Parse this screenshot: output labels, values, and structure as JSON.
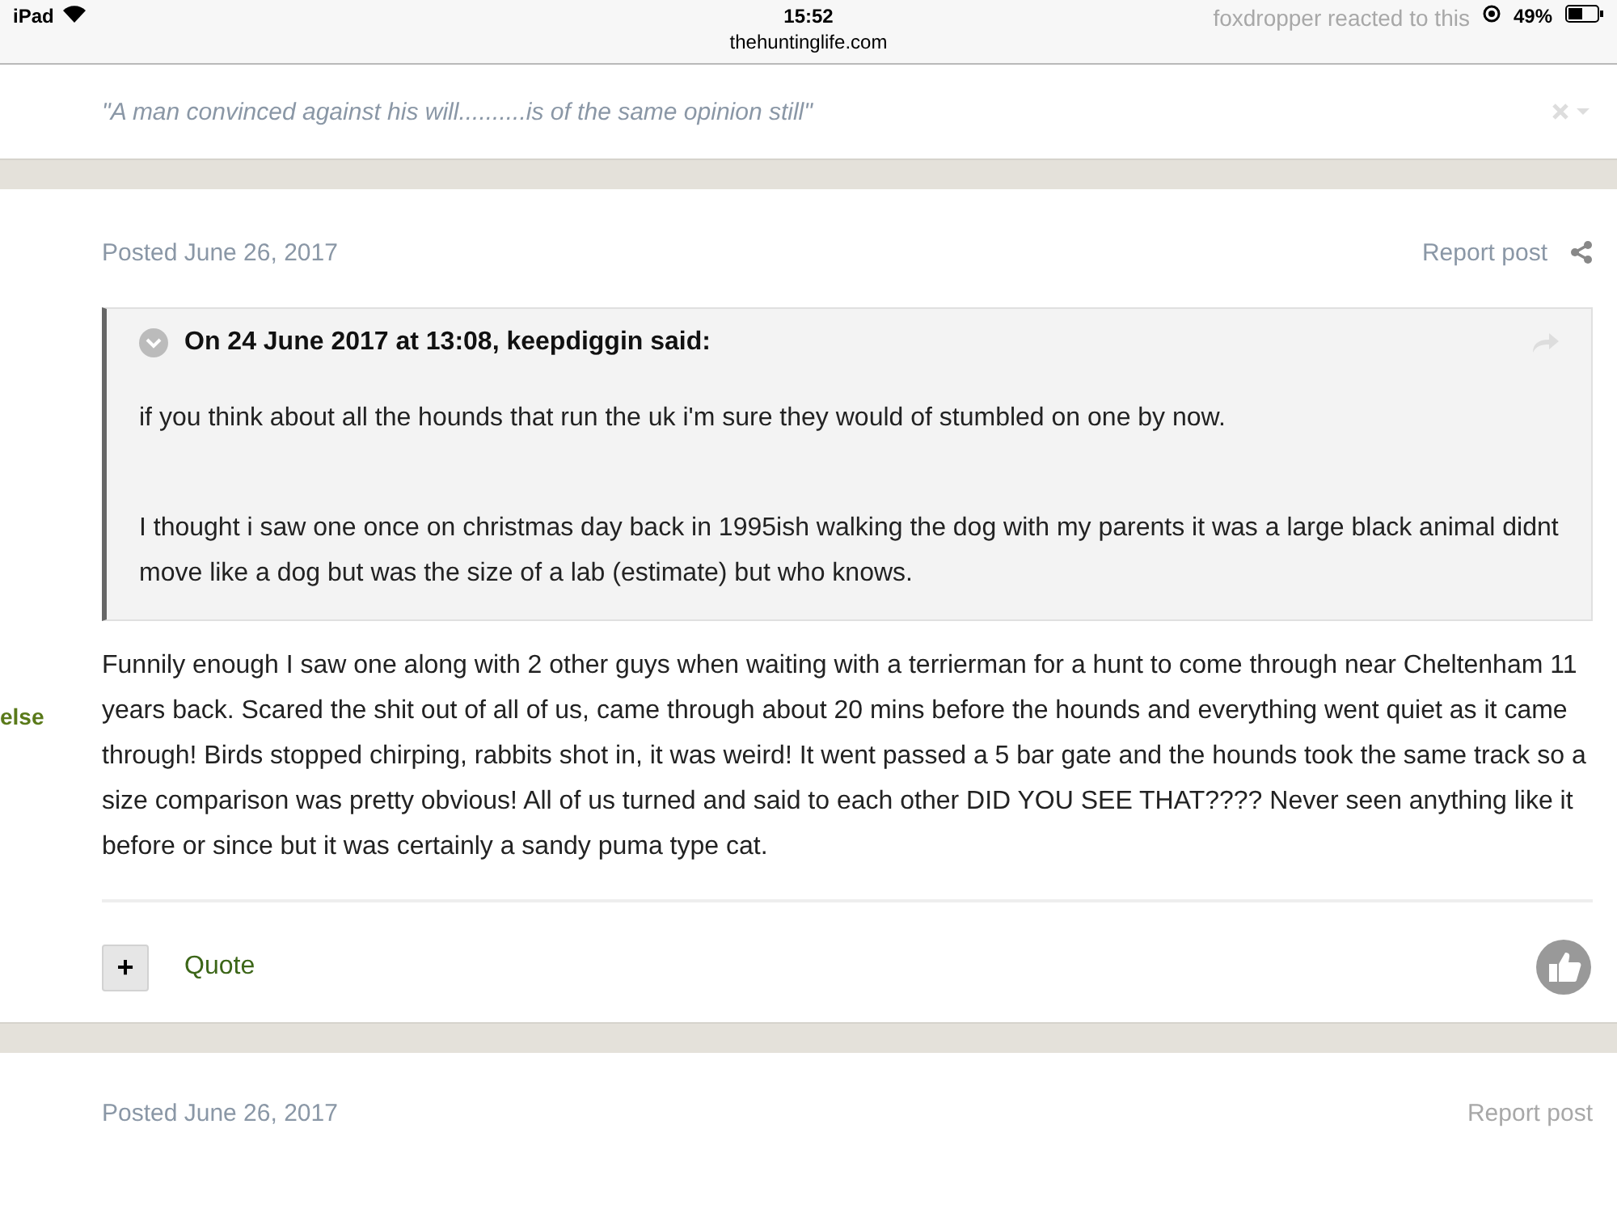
{
  "status_bar": {
    "device": "iPad",
    "time": "15:52",
    "url": "thehuntinglife.com",
    "notification": "foxdropper reacted to this",
    "battery": "49%"
  },
  "signature": {
    "text": "\"A man convinced against his will..........is of the same opinion still\""
  },
  "post": {
    "date": "Posted June 26, 2017",
    "report": "Report post",
    "author_fragment": "else",
    "quote": {
      "header": "On 24 June 2017 at 13:08, keepdiggin said:",
      "paragraphs": [
        "if you think about all the hounds that run the uk i'm sure they would of stumbled on one by now.",
        "I thought i saw one once on christmas day back in 1995ish walking the dog with my parents it was a large black animal didnt move like a dog but was the size of a lab (estimate) but who knows."
      ]
    },
    "body": "Funnily enough I saw one along with 2 other guys when waiting with a terrierman for a hunt to come through near Cheltenham 11 years back. Scared the shit out of all of us, came through about 20 mins before the hounds and everything went quiet as it came through! Birds stopped chirping, rabbits shot in, it was weird! It went passed a 5 bar gate and the hounds took the same track so a size comparison was pretty obvious! All of us turned and said to each other DID YOU SEE THAT???? Never seen anything like it before or since but it was certainly a sandy puma type cat.",
    "multiquote": "+",
    "quote_button": "Quote"
  },
  "next_post": {
    "date": "Posted June 26, 2017",
    "report": "Report post"
  }
}
